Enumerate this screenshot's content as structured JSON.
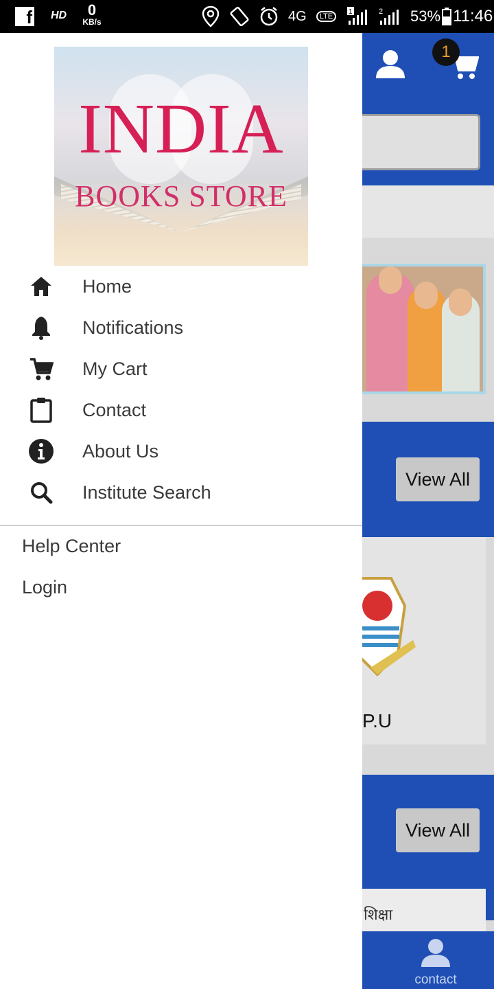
{
  "status_bar": {
    "app_icon": "f",
    "hd": "HD",
    "speed_value": "0",
    "speed_unit": "KB/s",
    "network": "4G",
    "volte": "LTE",
    "sim1": "1",
    "sim2": "2",
    "battery": "53%",
    "time": "11:46",
    "icons": [
      "location-icon",
      "rotate-icon",
      "alarm-icon",
      "signal-icon",
      "battery-icon"
    ]
  },
  "background_app": {
    "cart_count": "1",
    "view_all_1": "View All",
    "view_all_2": "View All",
    "card_label": "P.U",
    "card2_text": "शिक्षा",
    "bottom_nav_label": "contact",
    "header_color": "#1f4fb5"
  },
  "drawer": {
    "logo": {
      "title": "INDIA",
      "subtitle": "BOOKS STORE"
    },
    "menu": [
      {
        "label": "Home",
        "icon": "home-icon"
      },
      {
        "label": "Notifications",
        "icon": "bell-icon"
      },
      {
        "label": "My Cart",
        "icon": "cart-icon"
      },
      {
        "label": "Contact",
        "icon": "clipboard-icon"
      },
      {
        "label": "About Us",
        "icon": "info-icon"
      },
      {
        "label": "Institute Search",
        "icon": "search-icon"
      }
    ],
    "secondary": [
      {
        "label": "Help Center"
      },
      {
        "label": "Login"
      }
    ]
  }
}
